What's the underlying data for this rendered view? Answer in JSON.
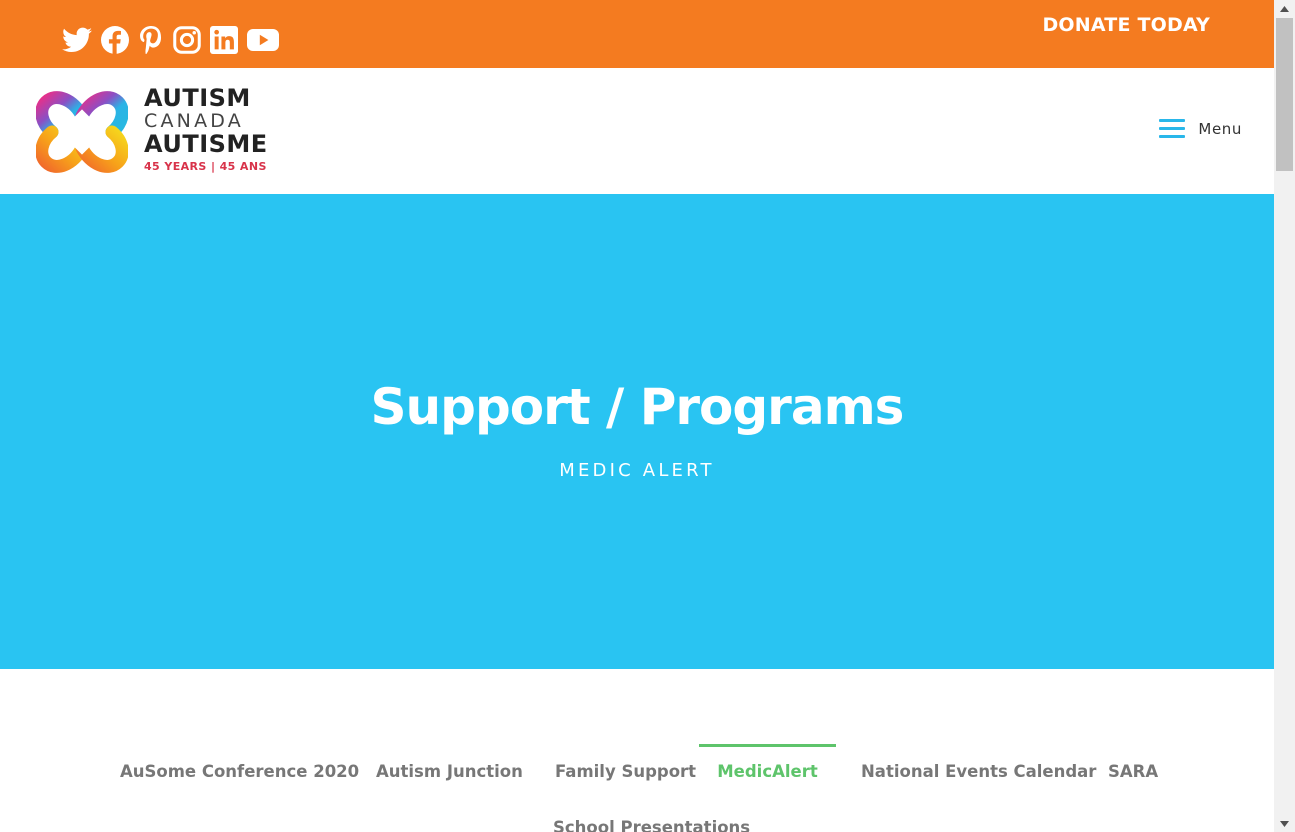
{
  "topbar": {
    "bg_color": "#f47b20",
    "social_icons": [
      "twitter-icon",
      "facebook-icon",
      "pinterest-icon",
      "instagram-icon",
      "linkedin-icon",
      "youtube-icon"
    ],
    "donate_label": "DONATE TODAY"
  },
  "header": {
    "logo": {
      "line1": "AUTISM",
      "line2": "CANADA",
      "line3": "AUTISME",
      "line4": "45 YEARS | 45 ANS"
    },
    "menu_label": "Menu",
    "menu_color": "#29b7ea"
  },
  "hero": {
    "bg_color": "#29c4f2",
    "title": "Support / Programs",
    "subtitle": "MEDIC ALERT"
  },
  "tabs": {
    "active_color": "#5ec46b",
    "items": [
      {
        "label": "AuSome Conference 2020",
        "active": false
      },
      {
        "label": "Autism Junction",
        "active": false
      },
      {
        "label": "Family Support",
        "active": false
      },
      {
        "label": "MedicAlert",
        "active": true
      },
      {
        "label": "National Events Calendar",
        "active": false
      },
      {
        "label": "SARA",
        "active": false
      },
      {
        "label": "School Presentations",
        "active": false
      }
    ]
  }
}
